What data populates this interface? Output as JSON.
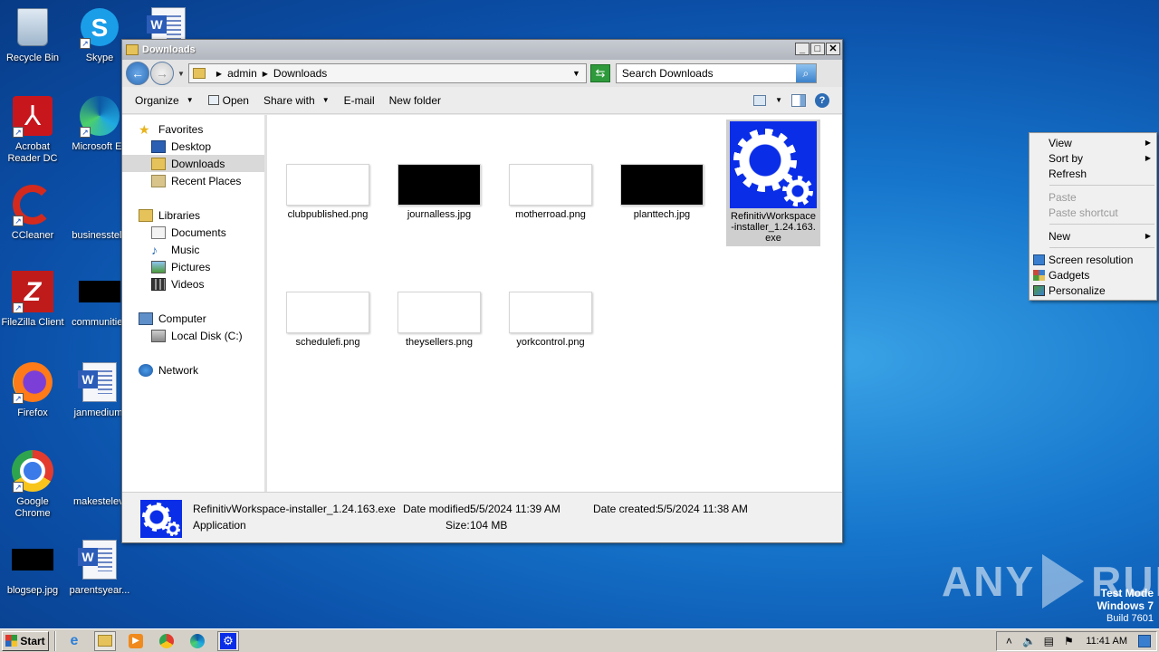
{
  "desktop": {
    "icons": [
      {
        "label": "Recycle Bin"
      },
      {
        "label": "Skype"
      },
      {
        "label": "Acrobat Reader DC"
      },
      {
        "label": "Microsoft Ed"
      },
      {
        "label": "CCleaner"
      },
      {
        "label": "businesstele"
      },
      {
        "label": "FileZilla Client"
      },
      {
        "label": "communities"
      },
      {
        "label": "Firefox"
      },
      {
        "label": "janmedium."
      },
      {
        "label": "Google Chrome"
      },
      {
        "label": "makestelevi"
      },
      {
        "label": "blogsep.jpg"
      },
      {
        "label": "parentsyear..."
      }
    ]
  },
  "window": {
    "title": "Downloads",
    "buttons": {
      "minimize": "_",
      "maximize": "□",
      "close": "✕"
    },
    "address": {
      "crumbs": [
        "admin",
        "Downloads"
      ]
    },
    "search": {
      "placeholder": "Search Downloads"
    },
    "toolbar": {
      "organize": "Organize",
      "open": "Open",
      "share_with": "Share with",
      "email": "E-mail",
      "new_folder": "New folder"
    },
    "nav": {
      "favorites": "Favorites",
      "desktop": "Desktop",
      "downloads": "Downloads",
      "recent": "Recent Places",
      "libraries": "Libraries",
      "documents": "Documents",
      "music": "Music",
      "pictures": "Pictures",
      "videos": "Videos",
      "computer": "Computer",
      "local_disk": "Local Disk (C:)",
      "network": "Network"
    },
    "files": [
      {
        "name": "clubpublished.png",
        "thumb": "white"
      },
      {
        "name": "journalless.jpg",
        "thumb": "black"
      },
      {
        "name": "motherroad.png",
        "thumb": "white"
      },
      {
        "name": "planttech.jpg",
        "thumb": "black"
      },
      {
        "name": "RefinitivWorkspace-installer_1.24.163.exe",
        "thumb": "gear",
        "lines": [
          "RefinitivWorkspace",
          "-installer_1.24.163.",
          "exe"
        ]
      },
      {
        "name": "schedulefi.png",
        "thumb": "white"
      },
      {
        "name": "theysellers.png",
        "thumb": "white"
      },
      {
        "name": "yorkcontrol.png",
        "thumb": "white"
      }
    ],
    "details": {
      "name": "RefinitivWorkspace-installer_1.24.163.exe",
      "type": "Application",
      "date_modified_label": "Date modified:",
      "date_modified": "5/5/2024 11:39 AM",
      "size_label": "Size:",
      "size": "104 MB",
      "date_created_label": "Date created:",
      "date_created": "5/5/2024 11:38 AM"
    }
  },
  "context_menu": {
    "view": "View",
    "sort_by": "Sort by",
    "refresh": "Refresh",
    "paste": "Paste",
    "paste_shortcut": "Paste shortcut",
    "new": "New",
    "screen_resolution": "Screen resolution",
    "gadgets": "Gadgets",
    "personalize": "Personalize"
  },
  "watermark": {
    "any": "ANY",
    "run": "RUN",
    "test_mode": "Test Mode",
    "os": "Windows 7",
    "build": "Build 7601"
  },
  "taskbar": {
    "start": "Start",
    "clock": "11:41 AM"
  }
}
